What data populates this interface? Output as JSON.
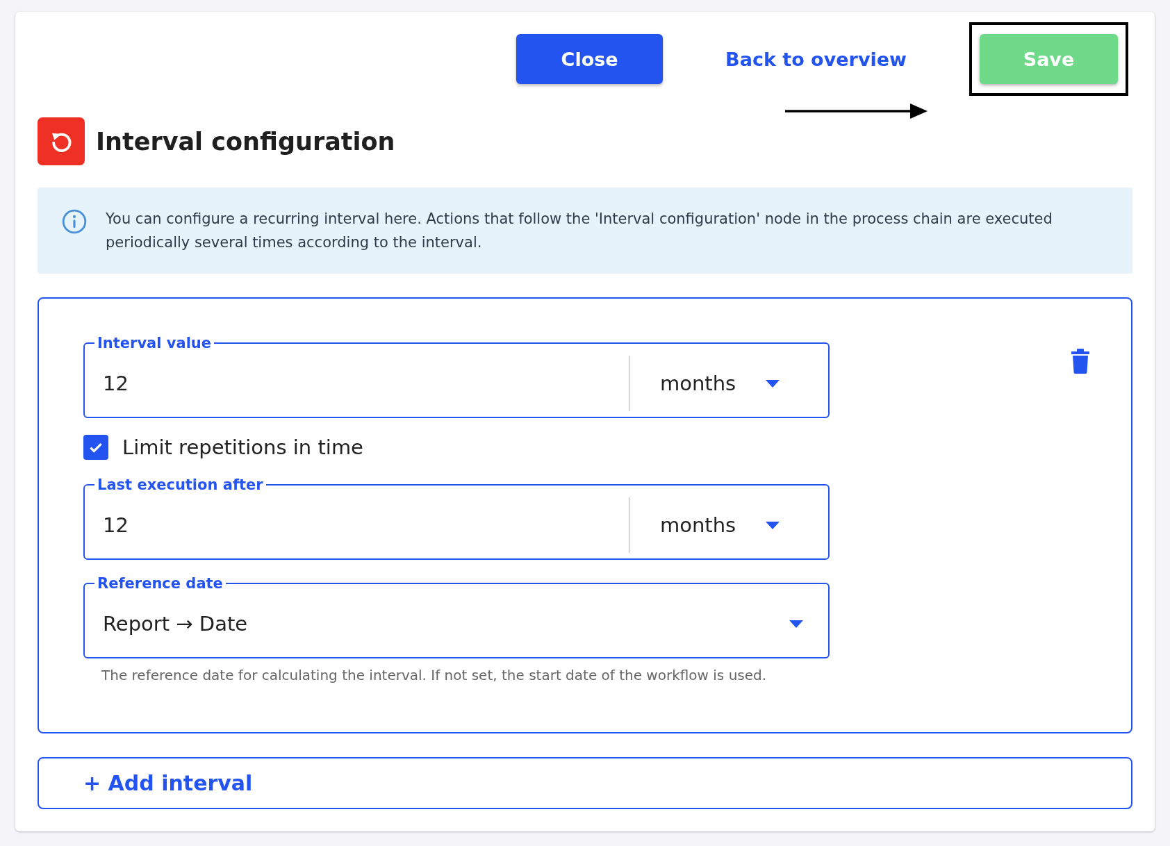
{
  "header_buttons": [
    {
      "kind": "primary",
      "label": "Close"
    },
    {
      "kind": "link",
      "label": "Back to overview"
    },
    {
      "kind": "success",
      "label": "Save"
    }
  ],
  "title": "Interval configuration",
  "info": "You can configure a recurring interval here. Actions that follow the 'Interval configuration' node in the process chain are executed periodically several times according to the interval.",
  "interval": {
    "interval_value": {
      "label": "Interval value",
      "value": "12",
      "unit": "months"
    },
    "limit": {
      "label": "Limit repetitions in time",
      "checked": true
    },
    "last_execution": {
      "label": "Last execution after",
      "value": "12",
      "unit": "months"
    },
    "reference_date": {
      "label": "Reference date",
      "value": "Report → Date",
      "helper": "The reference date for calculating the interval. If not set, the start date of the workflow is used."
    }
  },
  "add_button": "+ Add interval"
}
